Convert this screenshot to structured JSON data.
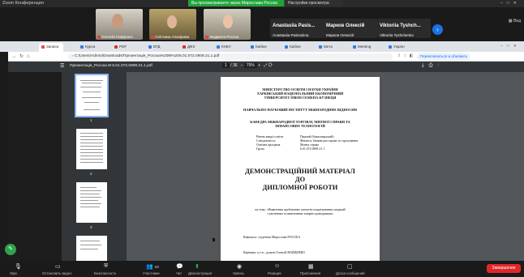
{
  "zoom": {
    "window_title": "Zoom Конференция",
    "share_banner": "Вы просматриваете экран Мирослава Росоха",
    "settings": "Настройки просмотра",
    "view_label": "Вид",
    "end_label": "Завершение",
    "participant_count": "10",
    "participants_tiles": [
      {
        "name": "Олексій Найденко"
      },
      {
        "name": "Світлана Алахірова"
      },
      {
        "name": "Людмила Росоха"
      }
    ],
    "camera_off_tiles": [
      {
        "big": "Anastasiia Pasis...",
        "name": "Anastasiia Pasisiulina"
      },
      {
        "big": "Марков Олексій",
        "name": "Марков Олексій"
      },
      {
        "big": "Viktoriia Tyshch...",
        "name": "Viktoriia Tyshchenko"
      }
    ],
    "controls": [
      "Звук",
      "Остановить видео",
      "Безопасность",
      "Участники",
      "Чат",
      "Демонстрация",
      "Запись",
      "Реакции",
      "Приложения",
      "Доска сообщений"
    ]
  },
  "browser": {
    "tabs": [
      {
        "label": "Записи",
        "color": "#e84a4a"
      },
      {
        "label": "Курси",
        "color": "#2f7de1"
      },
      {
        "label": "PDF",
        "color": "#d93025"
      },
      {
        "label": "ВТД",
        "color": "#2f7de1"
      },
      {
        "label": "ДФЗ",
        "color": "#d93025"
      },
      {
        "label": "КНЕУ",
        "color": "#2f7de1"
      },
      {
        "label": "Кабіне",
        "color": "#2f7de1"
      },
      {
        "label": "Кабіне",
        "color": "#2f7de1"
      },
      {
        "label": "Мета",
        "color": "#2f7de1"
      },
      {
        "label": "Meeting",
        "color": "#2f7de1"
      },
      {
        "label": "Україн",
        "color": "#2f7de1"
      }
    ],
    "url": "C:/Users/Admin/Downloads/Презентація_Росоха%20М%206.01.072.0909.21.1.pdf",
    "update_label": "Переключиться и обновить"
  },
  "pdf": {
    "file_name": "Презентація_Росоха М 6.01.072.0909.21.1.pdf",
    "page_current": "1",
    "page_total": "/ 36",
    "zoom": "75%",
    "thumbnails": [
      "1",
      "2",
      "3"
    ],
    "page": {
      "ministry": "МІНІСТЕРСТВО ОСВІТИ І НАУКИ УКРАЇНИ",
      "university_1": "ХАРКІВСЬКИЙ НАЦІОНАЛЬНИЙ ЕКОНОМІЧНИЙ",
      "university_2": "УНІВЕРСИТЕТ ІМЕНІ СЕМЕНА КУЗНЕЦЯ",
      "institute": "НАВЧАЛЬНО-НАУКОВИЙ ІНСТИТУТ МІЖНАРОДНИХ ВІДНОСИН",
      "department_1": "КАФЕДРА МІЖНАРОДНОЇ ТОРГІВЛІ, МИТНОЇ СПРАВИ ТА",
      "department_2": "ФІНАНСОВИХ ТЕХНОЛОГІЙ",
      "details": [
        {
          "k": "Рівень вищої освіти",
          "v": "Перший (бакалаврський)"
        },
        {
          "k": "Спеціальність",
          "v": "Фінанси, банківська справа та страхування"
        },
        {
          "k": "Освітня програма",
          "v": "Митна справа"
        },
        {
          "k": "Група",
          "v": "6.01.072.0909.21.1"
        }
      ],
      "title_1": "ДЕМОНСТРАЦІЙНИЙ МАТЕРІАЛ",
      "title_2": "ДО",
      "title_3": "ДИПЛОМНОЇ РОБОТИ",
      "topic_1": "на тему: «Виявлення проблемних аспектів оподаткування операцій",
      "topic_2": "з увезенням та вивезенням товарів громадянами»",
      "author": "Виконала: студентка Мирослава РОСОХА",
      "supervisor": "Керівник: к.е.н., доцент Олексій НАЙДЕНКО"
    }
  }
}
